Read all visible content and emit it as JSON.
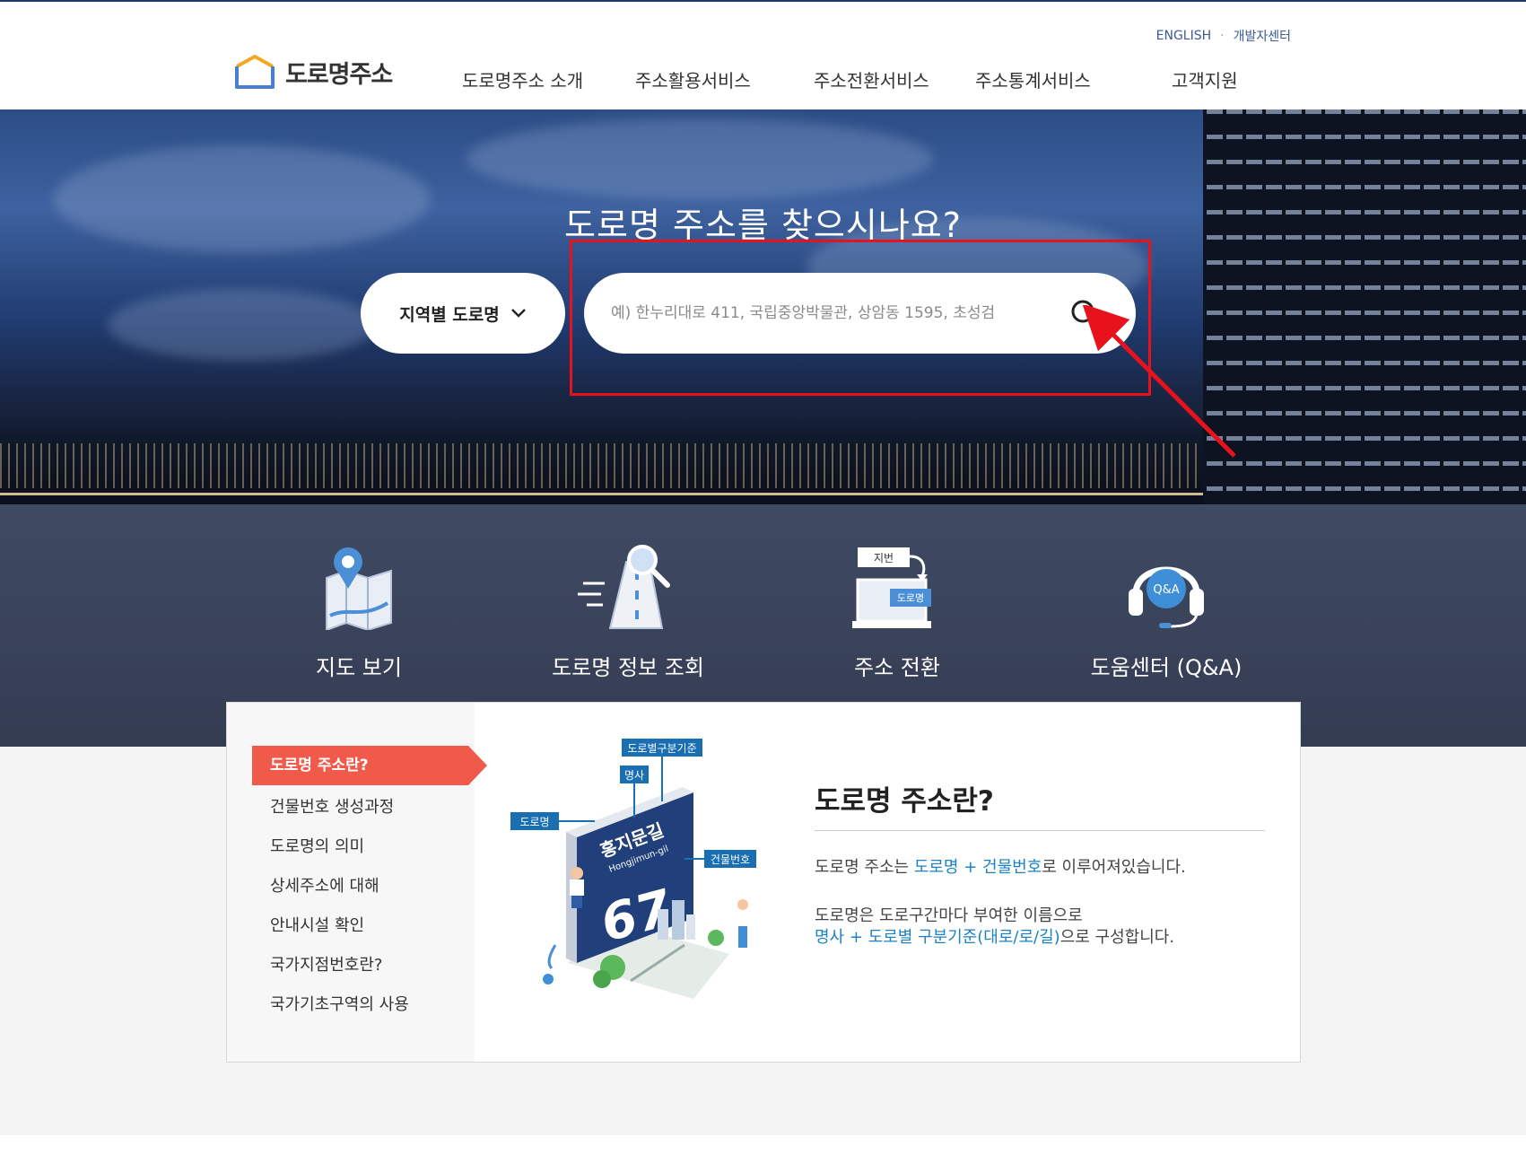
{
  "header": {
    "util_links": [
      "ENGLISH",
      "개발자센터"
    ],
    "logo_text": "도로명주소",
    "nav": [
      "도로명주소 소개",
      "주소활용서비스",
      "주소전환서비스",
      "주소통계서비스",
      "고객지원"
    ]
  },
  "hero": {
    "title": "도로명 주소를 찾으시나요?",
    "region_select": "지역별 도로명",
    "search_placeholder": "예) 한누리대로 411, 국립중앙박물관, 상암동 1595, 초성검"
  },
  "quick_links": [
    "지도 보기",
    "도로명 정보 조회",
    "주소 전환",
    "도움센터 (Q&A)"
  ],
  "icon_badges": {
    "jibeon": "지번",
    "doromyeong": "도로명",
    "qa": "Q&A"
  },
  "sidebar": {
    "active": "도로명 주소란?",
    "items": [
      "건물번호 생성과정",
      "도로명의 의미",
      "상세주소에 대해",
      "안내시설 확인",
      "국가지점번호란?",
      "국가기초구역의 사용"
    ]
  },
  "illustration": {
    "tag_criteria": "도로별구분기준",
    "tag_noun": "명사",
    "tag_road": "도로명",
    "tag_building": "건물번호",
    "sign_name": "홍지문길",
    "sign_roman": "Hongjimun-gil",
    "sign_number": "67"
  },
  "content": {
    "title": "도로명 주소란?",
    "p1_pre": "도로명 주소는 ",
    "p1_hl": "도로명 + 건물번호",
    "p1_post": "로 이루어져있습니다.",
    "p2_line1": "도로명은 도로구간마다 부여한 이름으로",
    "p2_hl": "명사 + 도로별 구분기준(대로/로/길)",
    "p2_post": "으로 구성합니다."
  }
}
